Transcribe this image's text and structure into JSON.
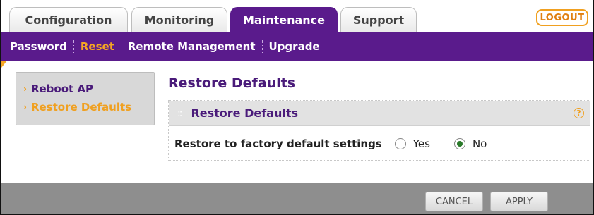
{
  "tabs": [
    {
      "label": "Configuration"
    },
    {
      "label": "Monitoring"
    },
    {
      "label": "Maintenance",
      "active": true
    },
    {
      "label": "Support"
    }
  ],
  "logout_label": "LOGOUT",
  "subnav": [
    {
      "label": "Password"
    },
    {
      "label": "Reset",
      "active": true
    },
    {
      "label": "Remote Management"
    },
    {
      "label": "Upgrade"
    }
  ],
  "sidebar": {
    "items": [
      {
        "label": "Reboot AP"
      },
      {
        "label": "Restore Defaults",
        "active": true
      }
    ]
  },
  "main": {
    "title": "Restore Defaults",
    "section": {
      "title": "Restore Defaults",
      "help_icon": "?",
      "row_label": "Restore to factory default settings",
      "options": [
        {
          "label": "Yes",
          "selected": false
        },
        {
          "label": "No",
          "selected": true
        }
      ]
    }
  },
  "footer": {
    "cancel_label": "CANCEL",
    "apply_label": "APPLY"
  },
  "colors": {
    "brand_purple": "#5a1b8c",
    "accent_orange": "#f5a623"
  }
}
